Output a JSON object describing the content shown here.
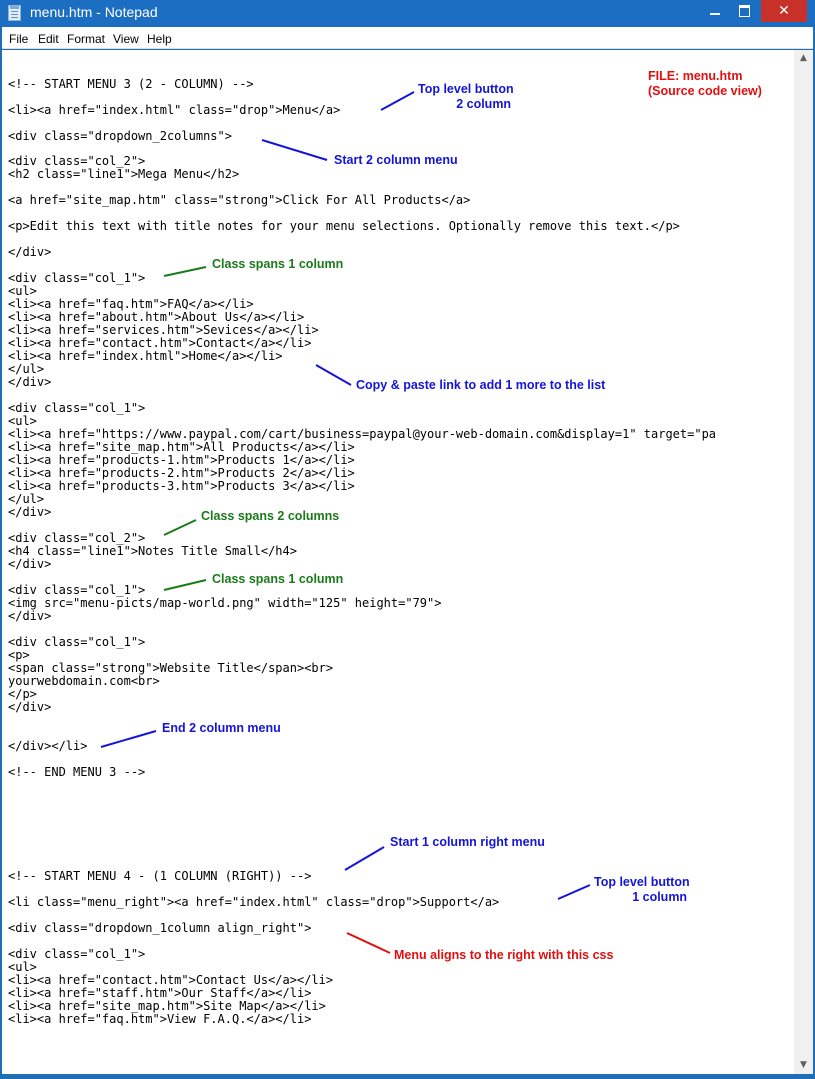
{
  "window": {
    "title": "menu.htm - Notepad",
    "close_glyph": "✕"
  },
  "menubar": {
    "file": "File",
    "edit": "Edit",
    "format": "Format",
    "view": "View",
    "help": "Help"
  },
  "scrollbar": {
    "up_glyph": "▲",
    "down_glyph": "▼"
  },
  "code": [
    "<!-- START MENU 3 (2 - COLUMN) -->",
    "<li><a href=\"index.html\" class=\"drop\">Menu</a>",
    "<div class=\"dropdown_2columns\">",
    "<div class=\"col_2\">",
    "<h2 class=\"line1\">Mega Menu</h2>",
    "<a href=\"site_map.htm\" class=\"strong\">Click For All Products</a>",
    "<p>Edit this text with title notes for your menu selections. Optionally remove this text.</p>",
    "</div>",
    "<div class=\"col_1\">",
    "<ul>",
    "<li><a href=\"faq.htm\">FAQ</a></li>",
    "<li><a href=\"about.htm\">About Us</a></li>",
    "<li><a href=\"services.htm\">Sevices</a></li>",
    "<li><a href=\"contact.htm\">Contact</a></li>",
    "<li><a href=\"index.html\">Home</a></li>",
    "</ul>",
    "</div>",
    "<div class=\"col_1\">",
    "<ul>",
    "<li><a href=\"https://www.paypal.com/cart/business=paypal@your-web-domain.com&display=1\" target=\"pa",
    "<li><a href=\"site_map.htm\">All Products</a></li>",
    "<li><a href=\"products-1.htm\">Products 1</a></li>",
    "<li><a href=\"products-2.htm\">Products 2</a></li>",
    "<li><a href=\"products-3.htm\">Products 3</a></li>",
    "</ul>",
    "</div>",
    "<div class=\"col_2\">",
    "<h4 class=\"line1\">Notes Title Small</h4>",
    "</div>",
    "<div class=\"col_1\">",
    "<img src=\"menu-picts/map-world.png\" width=\"125\" height=\"79\">",
    "</div>",
    "<div class=\"col_1\">",
    "<p>",
    "<span class=\"strong\">Website Title</span><br>",
    "yourwebdomain.com<br>",
    "</p>",
    "</div>",
    "</div></li>",
    "<!-- END MENU 3 -->",
    "<!-- START MENU 4 - (1 COLUMN (RIGHT)) -->",
    "<li class=\"menu_right\"><a href=\"index.html\" class=\"drop\">Support</a>",
    "<div class=\"dropdown_1column align_right\">",
    "<div class=\"col_1\">",
    "<ul>",
    "<li><a href=\"contact.htm\">Contact Us</a></li>",
    "<li><a href=\"staff.htm\">Our Staff</a></li>",
    "<li><a href=\"site_map.htm\">Site Map</a></li>",
    "<li><a href=\"faq.htm\">View F.A.Q.</a></li>"
  ],
  "annotations": [
    {
      "text": "Top level button\n           2 column",
      "color": "blue"
    },
    {
      "text": "FILE: menu.htm\n(Source code view)",
      "color": "red"
    },
    {
      "text": "Start 2 column menu",
      "color": "blue"
    },
    {
      "text": "Class spans 1 column",
      "color": "green"
    },
    {
      "text": "Copy & paste link to add 1 more to the list",
      "color": "blue"
    },
    {
      "text": "Class spans 2 columns",
      "color": "green"
    },
    {
      "text": "Class spans 1 column",
      "color": "green"
    },
    {
      "text": "End 2 column menu",
      "color": "blue"
    },
    {
      "text": "Start 1 column right menu",
      "color": "blue"
    },
    {
      "text": "Top level button\n           1 column",
      "color": "blue"
    },
    {
      "text": "Menu aligns to the right with this css",
      "color": "red"
    }
  ],
  "colors": {
    "blue": "#1515d9",
    "green": "#1a7a1a",
    "red": "#e01010",
    "titlebar": "#1b6ec2",
    "close": "#c7312a"
  }
}
